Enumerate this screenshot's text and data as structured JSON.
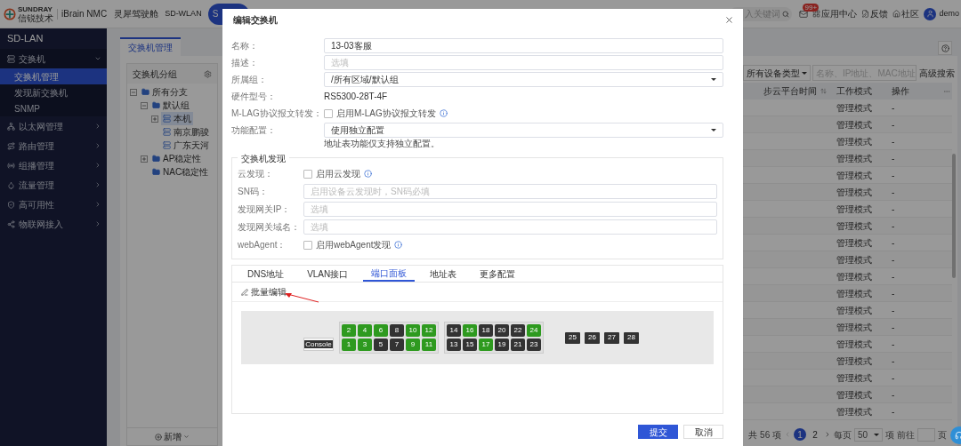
{
  "topbar": {
    "brand": {
      "logo_top": "SUNDRAY",
      "logo_bottom": "信锐技术",
      "product": "iBrain NMC"
    },
    "nav": [
      {
        "label": "灵犀驾驶舱",
        "selected": false
      },
      {
        "label": "SD-WLAN",
        "selected": false
      },
      {
        "label": "S",
        "selected": true
      }
    ],
    "search": {
      "placeholder": "入关键词"
    },
    "notifications": {
      "badge": "99+"
    },
    "links": [
      "应用中心",
      "反馈",
      "社区"
    ],
    "user": "demo"
  },
  "sidebar": {
    "title": "SD-LAN",
    "items": [
      {
        "label": "交换机",
        "expanded": true,
        "children": [
          {
            "label": "交换机管理",
            "selected": true
          },
          {
            "label": "发现新交换机",
            "selected": false
          },
          {
            "label": "SNMP",
            "selected": false
          }
        ]
      },
      {
        "label": "以太网管理",
        "expanded": false
      },
      {
        "label": "路由管理",
        "expanded": false
      },
      {
        "label": "组播管理",
        "expanded": false
      },
      {
        "label": "流量管理",
        "expanded": false
      },
      {
        "label": "高可用性",
        "expanded": false
      },
      {
        "label": "物联网接入",
        "expanded": false
      }
    ]
  },
  "tabs": [
    {
      "label": "交换机管理",
      "selected": true
    }
  ],
  "group_panel": {
    "title": "交换机分组",
    "add_button": "新增",
    "tree": [
      {
        "label": "所有分支",
        "kind": "folder",
        "expanded": true,
        "selected": false,
        "children": [
          {
            "label": "默认组",
            "kind": "folder",
            "expanded": true,
            "selected": false,
            "children": [
              {
                "label": "本机",
                "kind": "switch",
                "expanded": false,
                "selected": true
              },
              {
                "label": "南京鹏骏",
                "kind": "switch",
                "selected": false
              },
              {
                "label": "广东天河",
                "kind": "switch",
                "selected": false
              }
            ]
          },
          {
            "label": "AP稳定性",
            "kind": "folder",
            "expanded": false,
            "selected": false
          },
          {
            "label": "NAC稳定性",
            "kind": "folder",
            "selected": false
          }
        ]
      }
    ]
  },
  "table": {
    "filter": {
      "value": "所有设备类型"
    },
    "search": {
      "placeholder": "名称、IP地址、MAC地址"
    },
    "advanced": "高级搜索",
    "columns": [
      {
        "label": "步云平台时间",
        "sortable": true
      },
      {
        "label": "工作模式",
        "sortable": false
      },
      {
        "label": "操作",
        "sortable": false
      }
    ],
    "rows": [
      {
        "cells": [
          "",
          "管理模式",
          "-"
        ]
      },
      {
        "cells": [
          "",
          "管理模式",
          "-"
        ]
      },
      {
        "cells": [
          "",
          "管理模式",
          "-"
        ]
      },
      {
        "cells": [
          "",
          "管理模式",
          "-"
        ]
      },
      {
        "cells": [
          "",
          "管理模式",
          "-"
        ]
      },
      {
        "cells": [
          "",
          "管理模式",
          "-"
        ]
      },
      {
        "cells": [
          "",
          "管理模式",
          "-"
        ]
      },
      {
        "cells": [
          "",
          "管理模式",
          "-"
        ]
      },
      {
        "cells": [
          "",
          "管理模式",
          "-"
        ]
      },
      {
        "cells": [
          "",
          "管理模式",
          "-"
        ]
      },
      {
        "cells": [
          "",
          "管理模式",
          "-"
        ]
      },
      {
        "cells": [
          "",
          "管理模式",
          "-"
        ]
      },
      {
        "cells": [
          "",
          "管理模式",
          "-"
        ]
      },
      {
        "cells": [
          "",
          "管理模式",
          "-"
        ]
      },
      {
        "cells": [
          "",
          "管理模式",
          "-"
        ]
      },
      {
        "cells": [
          "",
          "管理模式",
          "-"
        ]
      },
      {
        "cells": [
          "",
          "管理模式",
          "-"
        ]
      },
      {
        "cells": [
          "",
          "管理模式",
          "-"
        ]
      },
      {
        "cells": [
          "",
          "管理模式",
          "-"
        ]
      }
    ]
  },
  "pagination": {
    "total": "共 56 项",
    "pages": [
      {
        "label": "1",
        "selected": true
      },
      {
        "label": "2",
        "selected": false
      }
    ],
    "per_page_label": "每页",
    "per_page": "50",
    "per_page_unit": "项",
    "goto_label": "前往",
    "goto_unit": "页"
  },
  "dialog": {
    "title": "编辑交换机",
    "fields": [
      {
        "kind": "input",
        "label": "名称：",
        "value": "13-03客服"
      },
      {
        "kind": "input",
        "label": "描述：",
        "placeholder": "选填"
      },
      {
        "kind": "select",
        "label": "所属组：",
        "value": "/所有区域/默认组"
      },
      {
        "kind": "text",
        "label": "硬件型号：",
        "value": "RS5300-28T-4F"
      },
      {
        "kind": "checkbox",
        "label": "M-LAG协议报文转发：",
        "option": "启用M-LAG协议报文转发",
        "checked": false
      },
      {
        "kind": "select",
        "label": "功能配置：",
        "value": "使用独立配置",
        "hint": "地址表功能仅支持独立配置。"
      }
    ],
    "discovery": {
      "legend": "交换机发现",
      "fields": [
        {
          "kind": "checkbox",
          "label": "云发现：",
          "option": "启用云发现",
          "checked": false
        },
        {
          "kind": "input",
          "label": "SN码：",
          "placeholder": "启用设备云发现时，SN码必填"
        },
        {
          "kind": "input",
          "label": "发现网关IP：",
          "placeholder": "选填"
        },
        {
          "kind": "input",
          "label": "发现网关域名：",
          "placeholder": "选填"
        },
        {
          "kind": "checkbox",
          "label": "webAgent：",
          "option": "启用webAgent发现",
          "checked": false
        }
      ]
    },
    "tabs": [
      {
        "label": "DNS地址",
        "selected": false
      },
      {
        "label": "VLAN接口",
        "selected": false
      },
      {
        "label": "端口面板",
        "selected": true
      },
      {
        "label": "地址表",
        "selected": false
      },
      {
        "label": "更多配置",
        "selected": false
      }
    ],
    "batch_edit": "批量编辑",
    "ports": {
      "console": "Console",
      "groups": [
        {
          "top": [
            {
              "label": "2",
              "up": true
            },
            {
              "label": "4",
              "up": true
            },
            {
              "label": "6",
              "up": true
            },
            {
              "label": "8",
              "up": false
            },
            {
              "label": "10",
              "up": true
            },
            {
              "label": "12",
              "up": true
            }
          ],
          "bottom": [
            {
              "label": "1",
              "up": true
            },
            {
              "label": "3",
              "up": true
            },
            {
              "label": "5",
              "up": false
            },
            {
              "label": "7",
              "up": false
            },
            {
              "label": "9",
              "up": true
            },
            {
              "label": "11",
              "up": true
            }
          ]
        },
        {
          "top": [
            {
              "label": "14",
              "up": false
            },
            {
              "label": "16",
              "up": true
            },
            {
              "label": "18",
              "up": false
            },
            {
              "label": "20",
              "up": false
            },
            {
              "label": "22",
              "up": false
            },
            {
              "label": "24",
              "up": true
            }
          ],
          "bottom": [
            {
              "label": "13",
              "up": false
            },
            {
              "label": "15",
              "up": false
            },
            {
              "label": "17",
              "up": true
            },
            {
              "label": "19",
              "up": false
            },
            {
              "label": "21",
              "up": false
            },
            {
              "label": "23",
              "up": false
            }
          ]
        }
      ],
      "sfp": [
        {
          "label": "25",
          "up": false
        },
        {
          "label": "26",
          "up": false
        },
        {
          "label": "27",
          "up": false
        },
        {
          "label": "28",
          "up": false
        }
      ]
    },
    "buttons": {
      "submit": "提交",
      "cancel": "取消"
    }
  }
}
